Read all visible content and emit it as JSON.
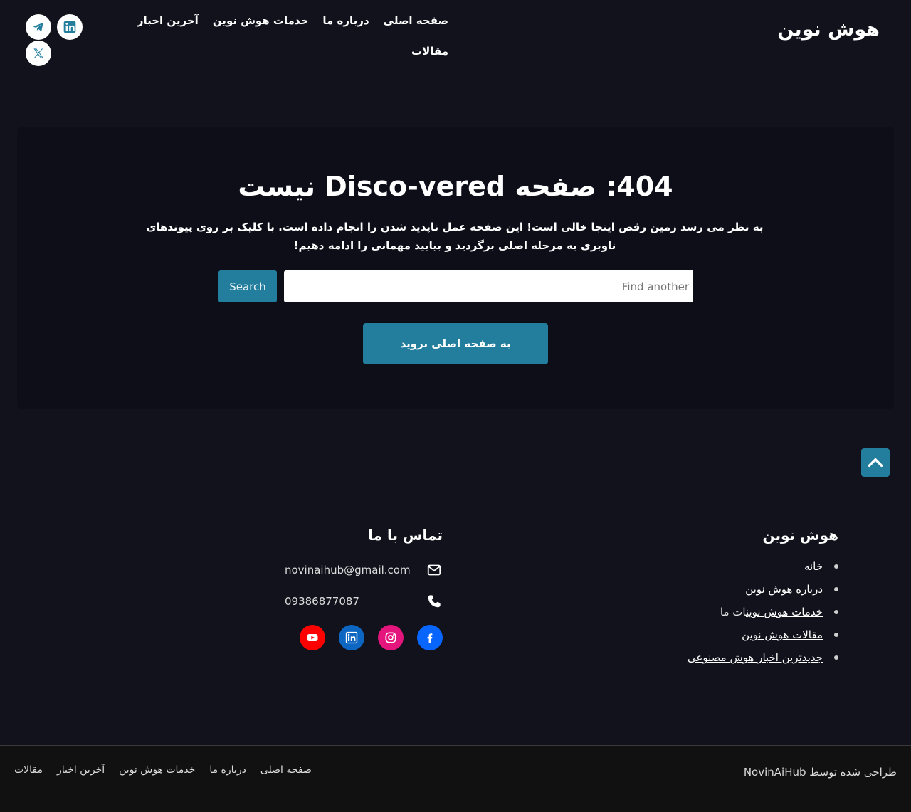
{
  "header": {
    "logo": "هوش نوین",
    "nav": [
      "صفحه اصلی",
      "درباره ما",
      "خدمات هوش نوین",
      "آخرین اخبار",
      "مقالات"
    ],
    "social_icons": [
      "telegram-icon",
      "linkedin-icon",
      "x-icon"
    ]
  },
  "main": {
    "title": "404: صفحه Disco-vered نیست",
    "description": "به نظر می رسد زمین رقص اینجا خالی است! این صفحه عمل ناپدید شدن را انجام داده است. با کلیک بر روی پیوندهای ناوبری به مرحله اصلی برگردید و بیایید مهمانی را ادامه دهیم!",
    "search_placeholder": "Find another",
    "search_button": "Search",
    "home_button": "به صفحه اصلی بروید"
  },
  "footer": {
    "brand_title": "هوش نوین",
    "links": [
      {
        "label": "خانه",
        "linked": true
      },
      {
        "label": "درباره هوش نوین",
        "linked": true
      },
      {
        "label": "خدمات هوش نوین",
        "suffix": "ات ما",
        "linked": true
      },
      {
        "label": "مقالات هوش نوین",
        "linked": true
      },
      {
        "label": "جدیدترین اخبار هوش مصنوعی",
        "linked": true
      }
    ],
    "contact_title": "تماس با ما",
    "email": "novinaihub@gmail.com",
    "phone": "09386877087",
    "social_icons": [
      "facebook-icon",
      "instagram-icon",
      "linkedin-icon",
      "youtube-icon"
    ]
  },
  "bottom": {
    "credit": "طراحی شده توسط NovinAiHub",
    "nav": [
      "صفحه اصلی",
      "درباره ما",
      "خدمات هوش نوین",
      "آخرین اخبار",
      "مقالات"
    ]
  },
  "colors": {
    "accent": "#237e9d",
    "background": "#12121c",
    "card": "#0e0e19"
  }
}
